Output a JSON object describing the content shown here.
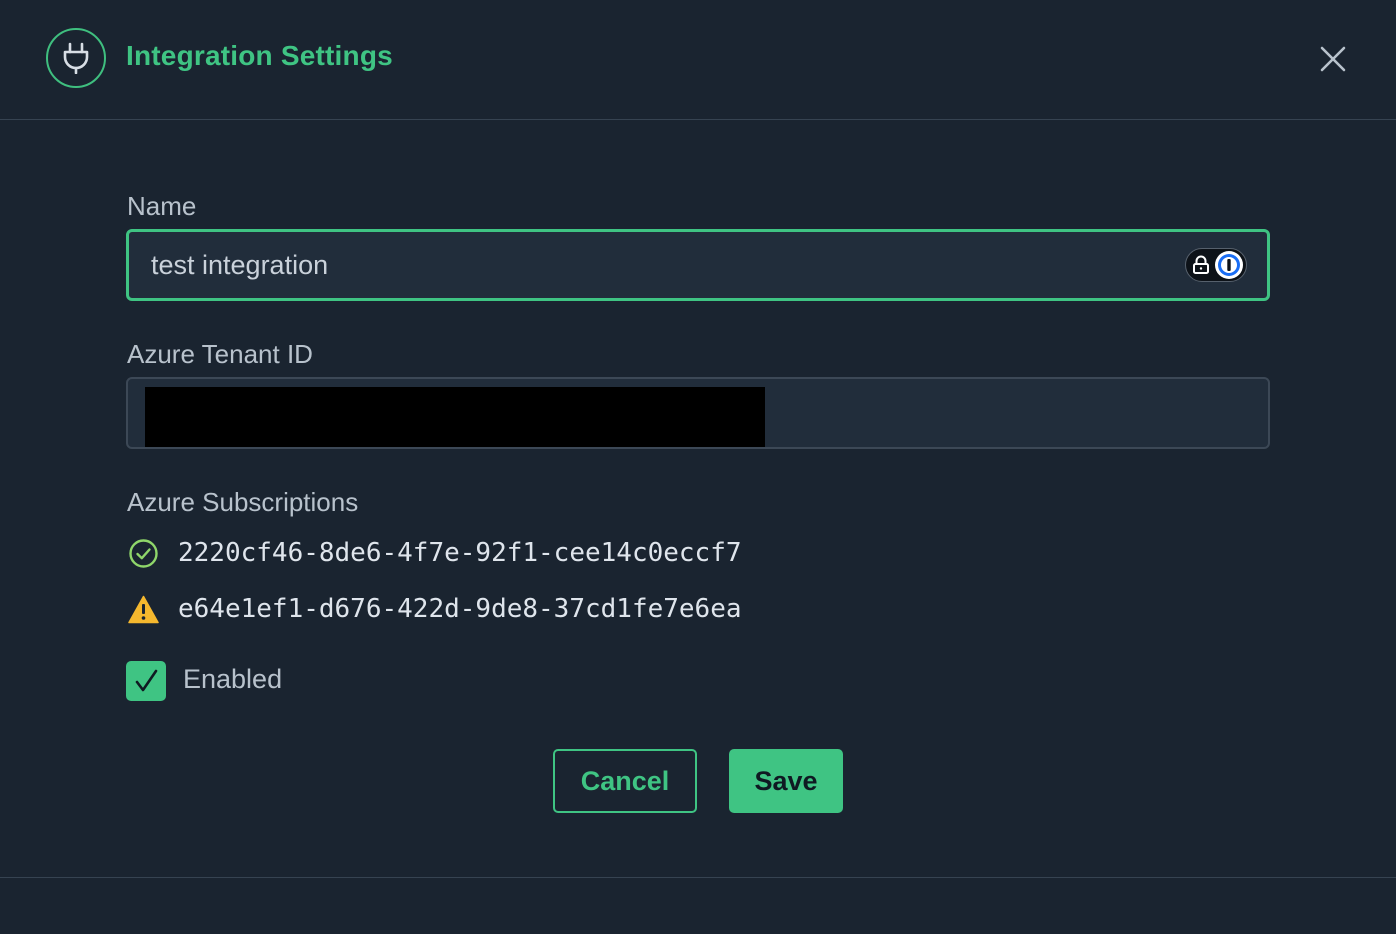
{
  "dialog": {
    "title": "Integration Settings",
    "header_icon": "plug-icon",
    "close_icon": "close-icon"
  },
  "form": {
    "name": {
      "label": "Name",
      "value": "test integration",
      "password_manager_icon": "1password-icon"
    },
    "tenant": {
      "label": "Azure Tenant ID",
      "value_redacted": true
    },
    "subscriptions": {
      "label": "Azure Subscriptions",
      "items": [
        {
          "id": "2220cf46-8de6-4f7e-92f1-cee14c0eccf7",
          "status": "ok",
          "icon": "check-circle-icon",
          "color": "#8fd66a"
        },
        {
          "id": "e64e1ef1-d676-422d-9de8-37cd1fe7e6ea",
          "status": "warning",
          "icon": "warning-icon",
          "color": "#f5b82e"
        }
      ]
    },
    "enabled": {
      "label": "Enabled",
      "checked": true
    }
  },
  "actions": {
    "cancel_label": "Cancel",
    "save_label": "Save"
  },
  "colors": {
    "accent": "#3fc483",
    "background": "#1a2430",
    "input_bg": "#212d3b"
  }
}
